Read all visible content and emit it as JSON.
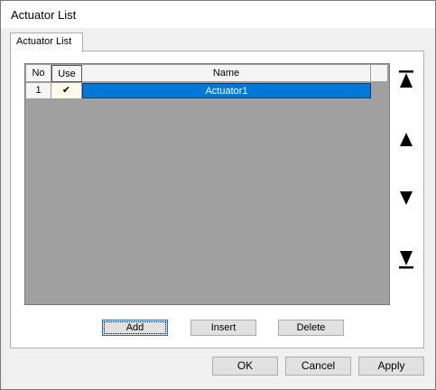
{
  "window": {
    "title": "Actuator List"
  },
  "tab": {
    "label": "Actuator List"
  },
  "grid": {
    "headers": {
      "no": "No",
      "use": "Use",
      "name": "Name"
    },
    "rows": [
      {
        "no": "1",
        "use": "✔",
        "name": "Actuator1"
      }
    ]
  },
  "side_buttons": {
    "top": "move-to-top-icon",
    "up": "move-up-icon",
    "down": "move-down-icon",
    "bottom": "move-to-bottom-icon"
  },
  "grid_buttons": {
    "add": "Add",
    "insert": "Insert",
    "delete": "Delete"
  },
  "dialog_buttons": {
    "ok": "OK",
    "cancel": "Cancel",
    "apply": "Apply"
  },
  "colors": {
    "selection": "#0078d7",
    "grid_background": "#a0a0a0"
  }
}
